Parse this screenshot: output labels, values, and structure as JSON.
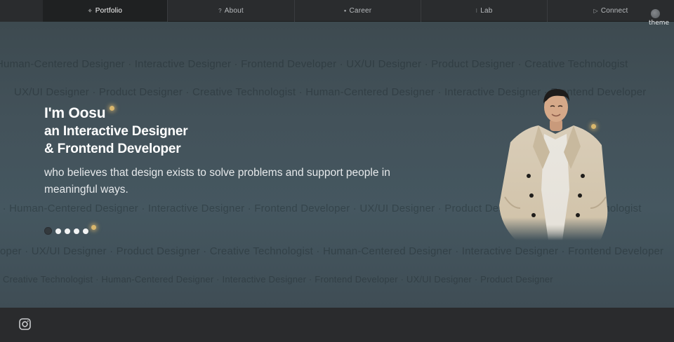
{
  "nav": {
    "items": [
      {
        "label": "Portfolio",
        "icon": "sparkle-icon",
        "glyph": "✧",
        "active": true
      },
      {
        "label": "About",
        "icon": "question-icon",
        "glyph": "?",
        "active": false
      },
      {
        "label": "Career",
        "icon": "circle-icon",
        "glyph": "●",
        "active": false
      },
      {
        "label": "Lab",
        "icon": "colon-icon",
        "glyph": "⁝",
        "active": false
      },
      {
        "label": "Connect",
        "icon": "play-icon",
        "glyph": "▷",
        "active": false
      }
    ]
  },
  "theme": {
    "label": "theme"
  },
  "hero": {
    "intro": "I'm Oosu",
    "line2": "an Interactive Designer",
    "line3": "& Frontend Developer",
    "tagline": "who believes that design exists to solve problems and support people in meaningful ways.",
    "marquee_rows": [
      "Human-Centered Designer  ·  Interactive Designer  ·  Frontend Developer  ·  UX/UI Designer  ·  Product Designer  ·  Creative Technologist",
      "UX/UI Designer  ·  Product Designer  ·  Creative Technologist  ·  Human-Centered Designer  ·  Interactive Designer  ·  Frontend Developer",
      "r  ·  Human-Centered Designer  ·  Interactive Designer  ·  Frontend Developer  ·  UX/UI Designer  ·  Product Designer  ·  Creative Technologist",
      "oper  ·  UX/UI Designer  ·  Product Designer  ·  Creative Technologist  ·  Human-Centered Designer  ·  Interactive Designer  ·  Frontend Developer",
      "Creative Technologist  ·  Human-Centered Designer  ·  Interactive Designer  ·  Frontend Developer  ·  UX/UI Designer  ·  Product Designer"
    ],
    "slide_count": 5,
    "active_slide": 1
  },
  "footer": {
    "icon": "instagram-icon"
  },
  "colors": {
    "accent": "#d9b76d",
    "hero_bg": "#43525a",
    "nav_bg": "#2a2c2e"
  }
}
